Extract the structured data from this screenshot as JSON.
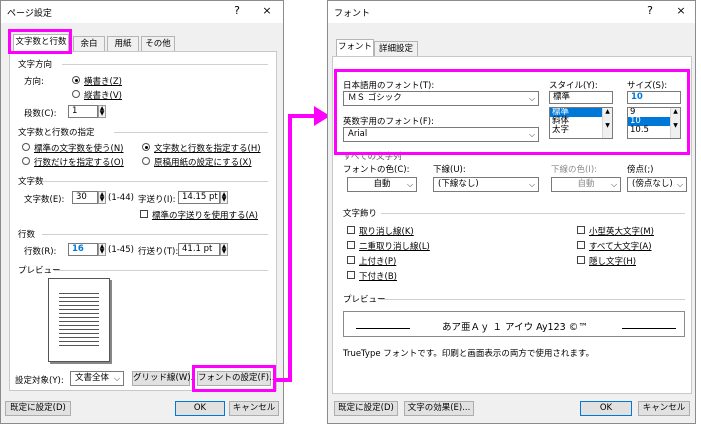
{
  "page_setup": {
    "title": "ページ設定",
    "help": "?",
    "close": "×",
    "tabs": [
      "文字数と行数",
      "余白",
      "用紙",
      "その他"
    ],
    "direction_section": "文字方向",
    "direction_label": "方向:",
    "direction_options": [
      "横書き(Z)",
      "縦書き(V)"
    ],
    "columns_label": "段数(C):",
    "columns_value": "1",
    "grid_section": "文字数と行数の指定",
    "grid_options": [
      "標準の文字数を使う(N)",
      "文字数と行数を指定する(H)",
      "行数だけを指定する(O)",
      "原稿用紙の設定にする(X)"
    ],
    "chars_section": "文字数",
    "chars_label": "文字数(E):",
    "chars_value": "30",
    "chars_range": "(1-44)",
    "pitch_label": "字送り(I):",
    "pitch_value": "14.15 pt",
    "default_pitch_check": "標準の字送りを使用する(A)",
    "lines_section": "行数",
    "lines_label": "行数(R):",
    "lines_value": "16",
    "lines_range": "(1-45)",
    "line_pitch_label": "行送り(T):",
    "line_pitch_value": "41.1 pt",
    "preview_section": "プレビュー",
    "apply_label": "設定対象(Y):",
    "apply_value": "文書全体",
    "grid_button": "グリッド線(W)...",
    "font_button": "フォントの設定(F)...",
    "default_button": "既定に設定(D)",
    "ok_button": "OK",
    "cancel_button": "キャンセル"
  },
  "font_dialog": {
    "title": "フォント",
    "help": "?",
    "close": "×",
    "tabs": [
      "フォント",
      "詳細設定"
    ],
    "jp_font_label": "日本語用のフォント(T):",
    "jp_font_value": "ＭＳ ゴシック",
    "style_label": "スタイル(Y):",
    "style_value": "標準",
    "style_list": [
      "標準",
      "斜体",
      "太字"
    ],
    "size_label": "サイズ(S):",
    "size_value": "10",
    "size_list": [
      "9",
      "10",
      "10.5"
    ],
    "en_font_label": "英数字用のフォント(F):",
    "en_font_value": "Arial",
    "all_chars_section": "すべての文字列",
    "font_color_label": "フォントの色(C):",
    "font_color_value": "自動",
    "underline_label": "下線(U):",
    "underline_value": "(下線なし)",
    "underline_color_label": "下線の色(I):",
    "underline_color_value": "自動",
    "emphasis_label": "傍点(;)",
    "emphasis_value": "(傍点なし)",
    "effects_section": "文字飾り",
    "effects_left": [
      "取り消し線(K)",
      "二重取り消し線(L)",
      "上付き(P)",
      "下付き(B)"
    ],
    "effects_right": [
      "小型英大文字(M)",
      "すべて大文字(A)",
      "隠し文字(H)"
    ],
    "preview_section": "プレビュー",
    "preview_text": "あア亜Ａｙ １ アイウ Ay123 ©™",
    "truetype_note": "TrueType フォントです。印刷と画面表示の両方で使用されます。",
    "default_button": "既定に設定(D)",
    "effects_button": "文字の効果(E)...",
    "ok_button": "OK",
    "cancel_button": "キャンセル"
  },
  "colors": {
    "highlight": "#ff00ff",
    "selection": "#0078d7"
  }
}
